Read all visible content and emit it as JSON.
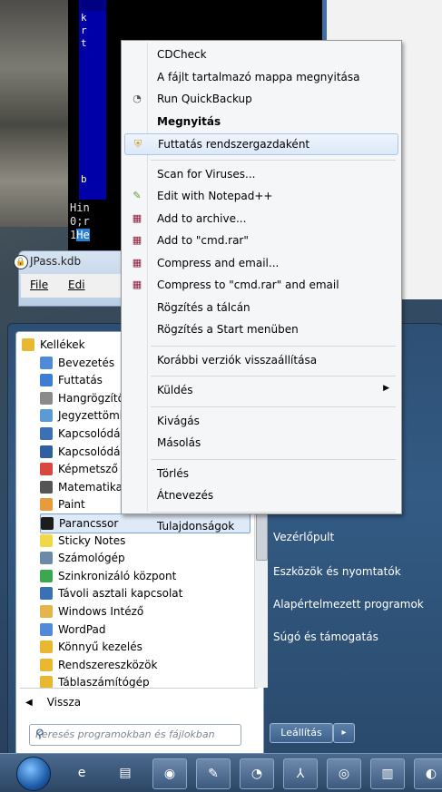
{
  "background": {
    "cmd_lines": [
      "Hin",
      "0;r",
      "1"
    ],
    "cmd_highlight": "He",
    "cmd_blue_letters": [
      "k",
      "r",
      "t",
      "b"
    ]
  },
  "jpass": {
    "title": "JPass.kdb",
    "menu": [
      "File",
      "Edi"
    ]
  },
  "start_menu": {
    "programs": [
      {
        "label": "Kellékek",
        "icon": "folder-icon",
        "color": "#e8b830"
      },
      {
        "label": "Bevezetés",
        "icon": "window-icon",
        "color": "#4f8bd8"
      },
      {
        "label": "Futtatás",
        "icon": "run-icon",
        "color": "#3d7ed4"
      },
      {
        "label": "Hangrögzítő",
        "icon": "microphone-icon",
        "color": "#8a8a8a"
      },
      {
        "label": "Jegyzettömb",
        "icon": "notepad-icon",
        "color": "#5b9bd5"
      },
      {
        "label": "Kapcsolódás",
        "icon": "projector-icon",
        "color": "#3b6fb6"
      },
      {
        "label": "Kapcsolódás",
        "icon": "remote-desktop-icon",
        "color": "#2f5f9f"
      },
      {
        "label": "Képmetsző",
        "icon": "scissors-icon",
        "color": "#d9473f"
      },
      {
        "label": "Matematikai",
        "icon": "math-pen-icon",
        "color": "#555555"
      },
      {
        "label": "Paint",
        "icon": "paint-icon",
        "color": "#e89b3a"
      },
      {
        "label": "Parancssor",
        "icon": "cmd-icon",
        "color": "#1c1c1c"
      },
      {
        "label": "Sticky Notes",
        "icon": "sticky-notes-icon",
        "color": "#f0d848"
      },
      {
        "label": "Számológép",
        "icon": "calculator-icon",
        "color": "#6d89a8"
      },
      {
        "label": "Szinkronizáló központ",
        "icon": "sync-center-icon",
        "color": "#3aa84f"
      },
      {
        "label": "Távoli asztali kapcsolat",
        "icon": "remote-desktop-icon",
        "color": "#3b6fb6"
      },
      {
        "label": "Windows Intéző",
        "icon": "explorer-icon",
        "color": "#e4b64a"
      },
      {
        "label": "WordPad",
        "icon": "wordpad-icon",
        "color": "#4f8bd8"
      },
      {
        "label": "Könnyű kezelés",
        "icon": "folder-icon",
        "color": "#e8b830"
      },
      {
        "label": "Rendszereszközök",
        "icon": "folder-icon",
        "color": "#e8b830"
      },
      {
        "label": "Táblaszámítógép",
        "icon": "folder-icon",
        "color": "#e8b830"
      }
    ],
    "selected_index": 10,
    "back_label": "Vissza",
    "search_placeholder": "Keresés programokban és fájlokban",
    "right_items": [
      "Vezérlőpult",
      "Eszközök és nyomtatók",
      "Alapértelmezett programok",
      "Súgó és támogatás"
    ],
    "shutdown_label": "Leállítás"
  },
  "context_menu": {
    "items": [
      {
        "label": "CDCheck",
        "icon": "",
        "bold": false,
        "highlight": false,
        "submenu": false
      },
      {
        "label": "A fájlt tartalmazó mappa megnyitása",
        "icon": "",
        "bold": false,
        "highlight": false,
        "submenu": false
      },
      {
        "label": "Run QuickBackup",
        "icon": "backup-icon",
        "bold": false,
        "highlight": false,
        "submenu": false
      },
      {
        "label": "Megnyitás",
        "icon": "",
        "bold": true,
        "highlight": false,
        "submenu": false
      },
      {
        "label": "Futtatás rendszergazdaként",
        "icon": "shield-icon",
        "bold": false,
        "highlight": true,
        "submenu": false
      },
      {
        "sep": true
      },
      {
        "label": "Scan for Viruses...",
        "icon": "",
        "bold": false,
        "highlight": false,
        "submenu": false
      },
      {
        "label": "Edit with Notepad++",
        "icon": "notepadpp-icon",
        "bold": false,
        "highlight": false,
        "submenu": false
      },
      {
        "label": "Add to archive...",
        "icon": "winrar-icon",
        "bold": false,
        "highlight": false,
        "submenu": false
      },
      {
        "label": "Add to \"cmd.rar\"",
        "icon": "winrar-icon",
        "bold": false,
        "highlight": false,
        "submenu": false
      },
      {
        "label": "Compress and email...",
        "icon": "winrar-icon",
        "bold": false,
        "highlight": false,
        "submenu": false
      },
      {
        "label": "Compress to \"cmd.rar\" and email",
        "icon": "winrar-icon",
        "bold": false,
        "highlight": false,
        "submenu": false
      },
      {
        "label": "Rögzítés a tálcán",
        "icon": "",
        "bold": false,
        "highlight": false,
        "submenu": false
      },
      {
        "label": "Rögzítés a Start menüben",
        "icon": "",
        "bold": false,
        "highlight": false,
        "submenu": false
      },
      {
        "sep": true
      },
      {
        "label": "Korábbi verziók visszaállítása",
        "icon": "",
        "bold": false,
        "highlight": false,
        "submenu": false
      },
      {
        "sep": true
      },
      {
        "label": "Küldés",
        "icon": "",
        "bold": false,
        "highlight": false,
        "submenu": true
      },
      {
        "sep": true
      },
      {
        "label": "Kivágás",
        "icon": "",
        "bold": false,
        "highlight": false,
        "submenu": false
      },
      {
        "label": "Másolás",
        "icon": "",
        "bold": false,
        "highlight": false,
        "submenu": false
      },
      {
        "sep": true
      },
      {
        "label": "Törlés",
        "icon": "",
        "bold": false,
        "highlight": false,
        "submenu": false
      },
      {
        "label": "Átnevezés",
        "icon": "",
        "bold": false,
        "highlight": false,
        "submenu": false
      },
      {
        "sep": true
      },
      {
        "label": "Tulajdonságok",
        "icon": "",
        "bold": false,
        "highlight": false,
        "submenu": false
      }
    ]
  },
  "taskbar": {
    "items": [
      {
        "icon": "internet-explorer-icon",
        "glyph": "e"
      },
      {
        "icon": "file-explorer-icon",
        "glyph": "▤"
      },
      {
        "icon": "firefox-icon",
        "glyph": "◉"
      },
      {
        "icon": "paint-app-icon",
        "glyph": "✎"
      },
      {
        "icon": "backup-app-icon",
        "glyph": "◔"
      },
      {
        "icon": "acrobat-icon",
        "glyph": "⅄"
      },
      {
        "icon": "jpass-icon",
        "glyph": "◎"
      },
      {
        "icon": "film-icon",
        "glyph": "▥"
      },
      {
        "icon": "extra-icon",
        "glyph": "◐"
      }
    ]
  }
}
